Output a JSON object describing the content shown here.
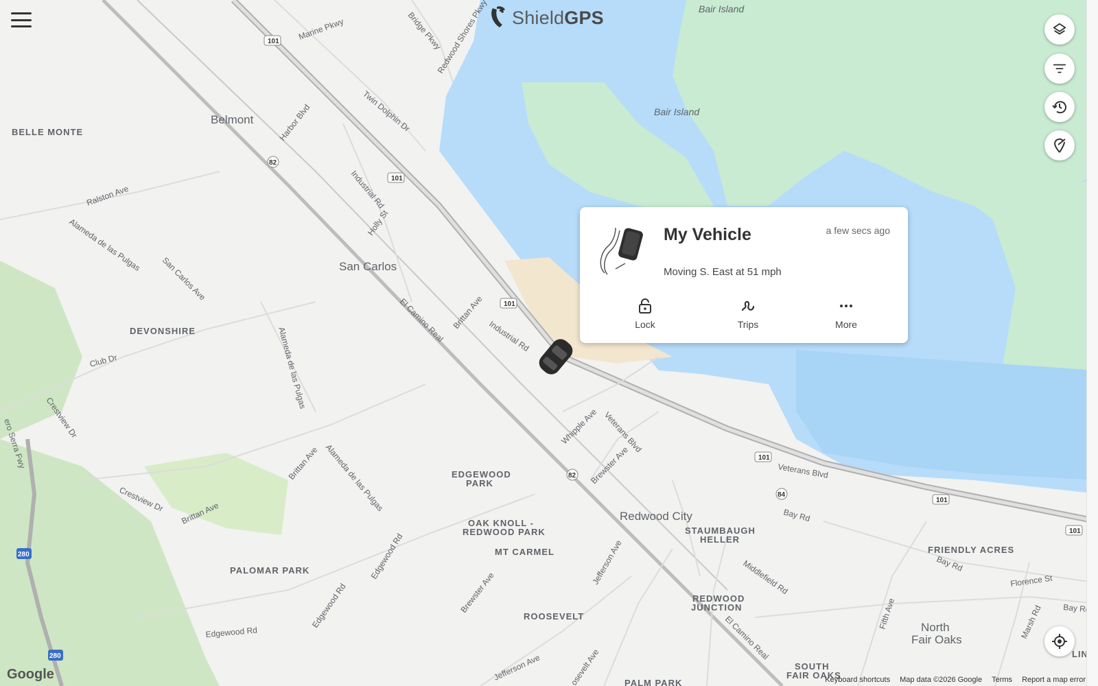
{
  "app": {
    "brand_light": "Shield",
    "brand_bold": "GPS"
  },
  "vehicle_card": {
    "name": "My Vehicle",
    "time_ago": "a few secs ago",
    "status": "Moving S. East at 51 mph",
    "actions": [
      {
        "label": "Lock",
        "icon": "lock-icon"
      },
      {
        "label": "Trips",
        "icon": "trips-icon"
      },
      {
        "label": "More",
        "icon": "more-icon"
      }
    ]
  },
  "controls": {
    "menu": "menu-icon",
    "right_buttons": [
      "layers-icon",
      "filter-icon",
      "history-icon",
      "geofence-icon"
    ],
    "locate": "locate-icon"
  },
  "map": {
    "places": {
      "bair_island_top": "Bair Island",
      "bair_island": "Bair Island",
      "belmont": "Belmont",
      "belle_monte": "BELLE MONTE",
      "san_carlos": "San Carlos",
      "devonshire": "DEVONSHIRE",
      "edgewood_park": [
        "EDGEWOOD",
        "PARK"
      ],
      "oak_knoll": [
        "OAK KNOLL -",
        "REDWOOD PARK"
      ],
      "mt_carmel": "MT CARMEL",
      "palomar_park": "PALOMAR PARK",
      "redwood_city": "Redwood City",
      "staumbaugh": [
        "STAUMBAUGH",
        "HELLER"
      ],
      "friendly_acres": "FRIENDLY ACRES",
      "redwood_junction": [
        "REDWOOD",
        "JUNCTION"
      ],
      "roosevelt": "ROOSEVELT",
      "north_fair_oaks": [
        "North",
        "Fair Oaks"
      ],
      "south_fair_oaks": [
        "SOUTH",
        "FAIR OAKS"
      ],
      "palm_park": "PALM PARK",
      "lin": "LIN"
    },
    "roads": {
      "marine_pkwy": "Marine Pkwy",
      "bridge_pkwy": "Bridge Pkwy",
      "redwood_shores_pkwy": "Redwood Shores Pkwy",
      "twin_dolphin": "Twin Dolphin Dr",
      "harbor_blvd": "Harbor Blvd",
      "industrial_rd_1": "Industrial Rd",
      "holly_st": "Holly St",
      "ralston_ave": "Ralston Ave",
      "alameda_1": "Alameda de las Pulgas",
      "san_carlos_ave": "San Carlos Ave",
      "el_camino_1": "El Camino Real",
      "brittan_ave_1": "Brittan Ave",
      "industrial_rd_2": "Industrial Rd",
      "club_dr": "Club Dr",
      "crestview_1": "Crestview Dr",
      "alameda_2": "Alameda de las Pulgas",
      "whipple_ave": "Whipple Ave",
      "veterans_1": "Veterans Blvd",
      "brewster_1": "Brewster Ave",
      "veterans_2": "Veterans Blvd",
      "brittan_ave_2": "Brittan Ave",
      "alameda_3": "Alameda de las Pulgas",
      "crestview_2": "Crestview Dr",
      "brittan_ave_3": "Brittan Ave",
      "junipero": "ero Serra Fwy",
      "bay_rd_1": "Bay Rd",
      "middlefield": "Middlefield Rd",
      "bay_rd_2": "Bay Rd",
      "florence_st": "Florence St",
      "bay_rd_3": "Bay Rd",
      "fifth_ave": "Fifth Ave",
      "marsh_rd": "Marsh Rd",
      "jefferson_1": "Jefferson Ave",
      "brewster_2": "Brewster Ave",
      "edgewood_1": "Edgewood Rd",
      "edgewood_2": "Edgewood Rd",
      "edgewood_3": "Edgewood Rd",
      "el_camino_2": "El Camino Real",
      "jefferson_2": "Jefferson Ave",
      "roosevelt_ave": "osevelt Ave"
    },
    "shields": {
      "s101_a": "101",
      "s101_b": "101",
      "s101_c": "101",
      "s101_d": "101",
      "s101_e": "101",
      "s101_f": "101",
      "s82_a": "82",
      "s82_b": "82",
      "s84": "84",
      "s280": "280",
      "s280_b": "280"
    }
  },
  "footer": {
    "google": "Google",
    "keyboard": "Keyboard shortcuts",
    "map_data": "Map data ©2026 Google",
    "terms": "Terms",
    "report": "Report a map error"
  }
}
